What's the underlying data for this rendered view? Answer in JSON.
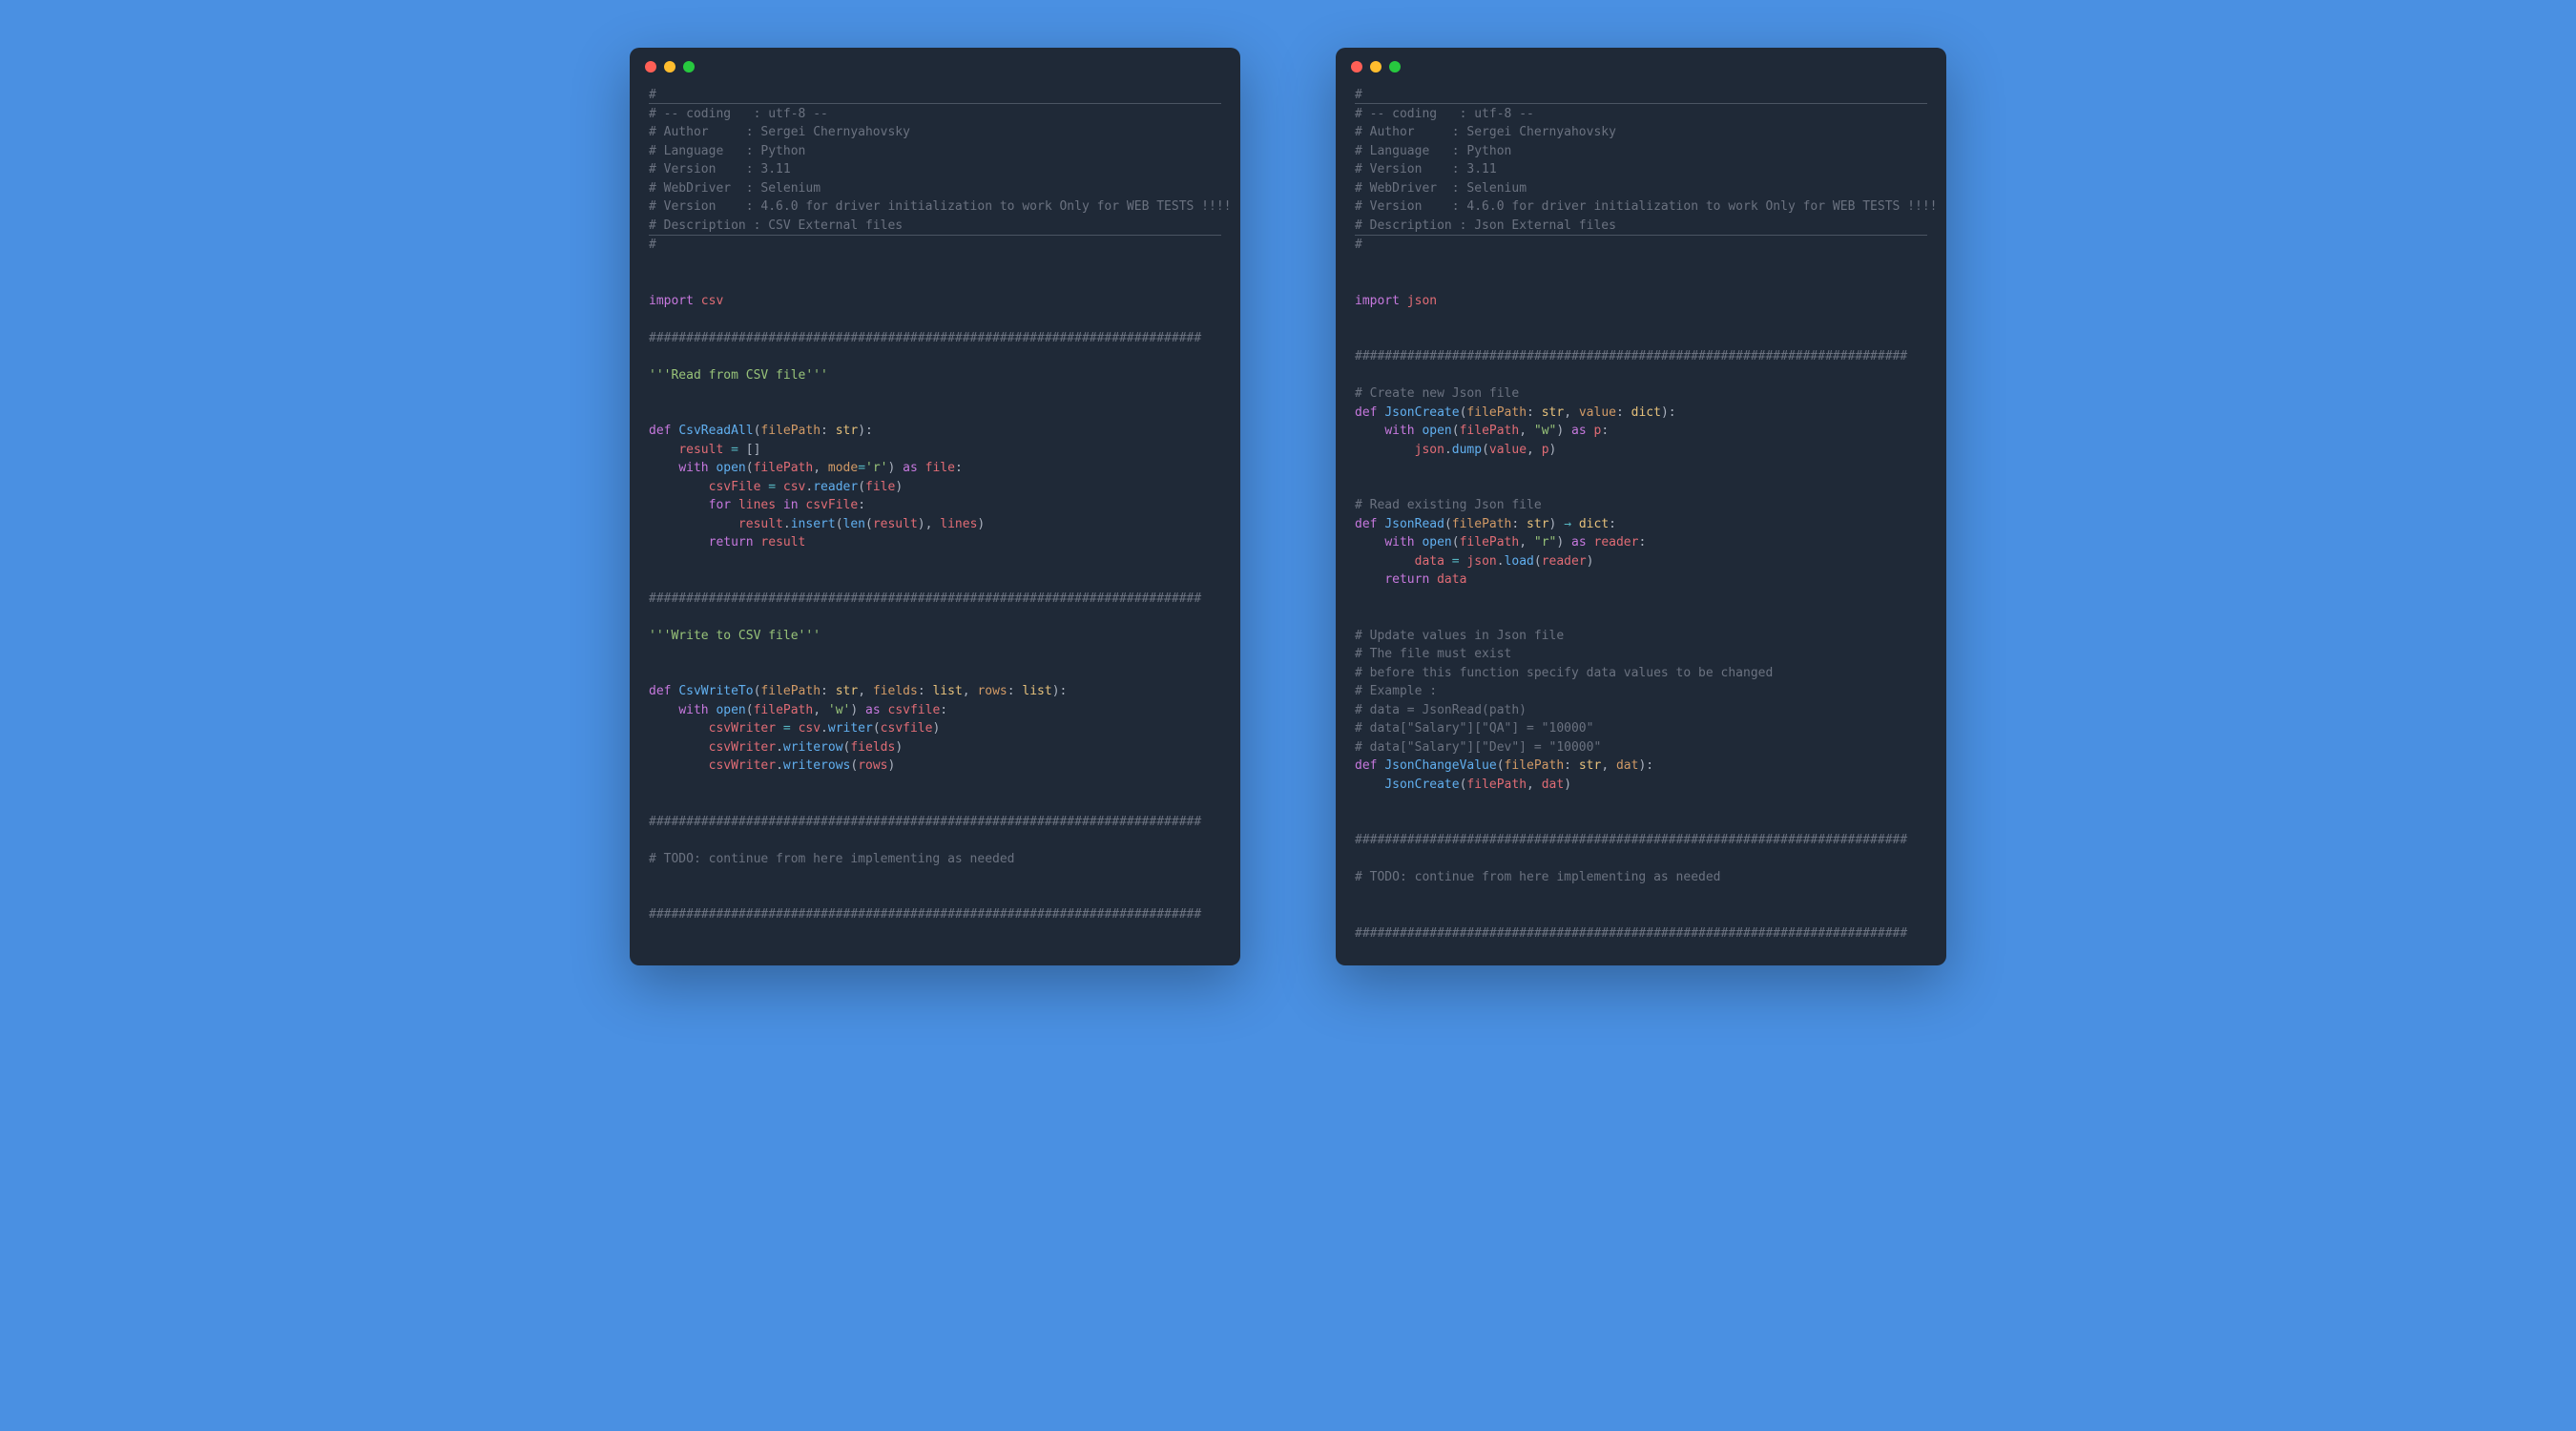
{
  "left": {
    "header": {
      "coding_label": "-- coding   : ",
      "coding_value": "utf-8 --",
      "author_label": "Author     : ",
      "author_value": "Sergei Chernyahovsky",
      "language_label": "Language   : ",
      "language_value": "Python",
      "version_label": "Version    : ",
      "version_value": "3.11",
      "webdriver_label": "WebDriver  : ",
      "webdriver_value": "Selenium",
      "drvversion_label": "Version    : ",
      "drvversion_value": "4.6.0 for driver initialization to work Only for WEB TESTS !!!!",
      "desc_label": "Description : ",
      "desc_value": "CSV External files"
    },
    "import_kw": "import",
    "import_mod": "csv",
    "hash_divider": "##########################################################################",
    "section_read": "'''Read from CSV file'''",
    "def_kw": "def",
    "fn_read": "CsvReadAll",
    "param_filepath": "filePath",
    "type_str": "str",
    "result_var": "result",
    "empty_list": "[]",
    "with_kw": "with",
    "open_fn": "open",
    "mode_param": "mode",
    "mode_r": "'r'",
    "as_kw": "as",
    "file_var": "file",
    "csvfile_var": "csvFile",
    "csv_mod": "csv",
    "reader_fn": "reader",
    "for_kw": "for",
    "lines_var": "lines",
    "in_kw": "in",
    "insert_fn": "insert",
    "len_fn": "len",
    "return_kw": "return",
    "section_write": "'''Write to CSV file'''",
    "fn_write": "CsvWriteTo",
    "param_fields": "fields",
    "type_list": "list",
    "param_rows": "rows",
    "mode_w": "'w'",
    "csvfile2_var": "csvfile",
    "csvwriter_var": "csvWriter",
    "writer_fn": "writer",
    "writerow_fn": "writerow",
    "writerows_fn": "writerows",
    "todo": "# TODO: continue from here implementing as needed"
  },
  "right": {
    "header": {
      "coding_label": "-- coding   : ",
      "coding_value": "utf-8 --",
      "author_label": "Author     : ",
      "author_value": "Sergei Chernyahovsky",
      "language_label": "Language   : ",
      "language_value": "Python",
      "version_label": "Version    : ",
      "version_value": "3.11",
      "webdriver_label": "WebDriver  : ",
      "webdriver_value": "Selenium",
      "drvversion_label": "Version    : ",
      "drvversion_value": "4.6.0 for driver initialization to work Only for WEB TESTS !!!!",
      "desc_label": "Description : ",
      "desc_value": "Json External files"
    },
    "import_kw": "import",
    "import_mod": "json",
    "hash_divider": "##########################################################################",
    "cmt_create": "# Create new Json file",
    "def_kw": "def",
    "fn_create": "JsonCreate",
    "param_filepath": "filePath",
    "type_str": "str",
    "param_value": "value",
    "type_dict": "dict",
    "with_kw": "with",
    "open_fn": "open",
    "mode_w": "\"w\"",
    "as_kw": "as",
    "p_var": "p",
    "json_mod": "json",
    "dump_fn": "dump",
    "cmt_read": "# Read existing Json file",
    "fn_read": "JsonRead",
    "arrow": "→",
    "mode_r": "\"r\"",
    "reader_var": "reader",
    "data_var": "data",
    "load_fn": "load",
    "return_kw": "return",
    "cmt_update1": "# Update values in Json file",
    "cmt_update2": "# The file must exist",
    "cmt_update3": "# before this function specify data values to be changed",
    "cmt_update4": "# Example :",
    "cmt_update5": "# data = JsonRead(path)",
    "cmt_update6": "# data[\"Salary\"][\"QA\"] = \"10000\"",
    "cmt_update7": "# data[\"Salary\"][\"Dev\"] = \"10000\"",
    "fn_change": "JsonChangeValue",
    "param_dat": "dat",
    "todo": "# TODO: continue from here implementing as needed"
  }
}
